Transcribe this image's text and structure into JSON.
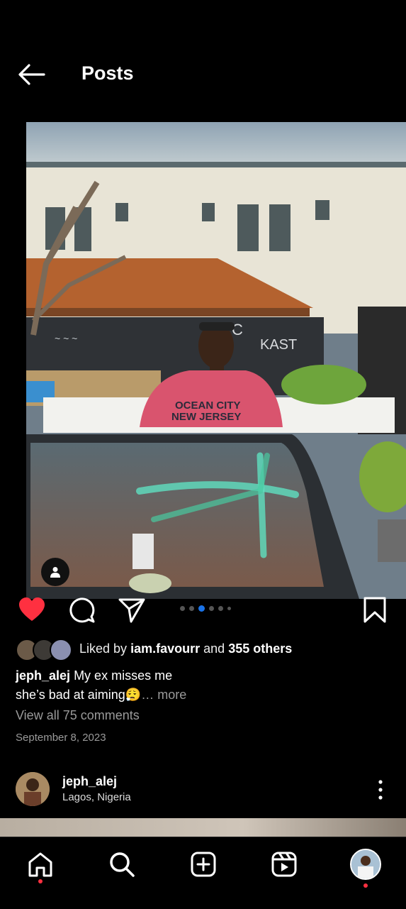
{
  "header": {
    "title": "Posts",
    "back_icon": "back-arrow-icon"
  },
  "post": {
    "image_alt_subject": "",
    "carousel": {
      "total": 6,
      "active": 2
    },
    "actions": {
      "like_icon": "heart-filled-icon",
      "like_color": "#ff3040",
      "comment_icon": "comment-icon",
      "share_icon": "send-icon",
      "save_icon": "bookmark-icon"
    },
    "likes": {
      "prefix": "Liked by",
      "user": "iam.favourr",
      "middle": "and",
      "others": "355 others"
    },
    "caption": {
      "username": "jeph_alej",
      "line1": "My ex misses me",
      "line2": "she’s bad at aiming",
      "emoji": "😮‍💨",
      "more": "… more"
    },
    "view_comments": "View all 75 comments",
    "date": "September 8, 2023"
  },
  "next_post": {
    "username": "jeph_alej",
    "location": "Lagos, Nigeria",
    "more_icon": "more-vertical-icon"
  },
  "bottom_nav": {
    "items": [
      {
        "icon": "home-icon"
      },
      {
        "icon": "search-icon"
      },
      {
        "icon": "create-icon"
      },
      {
        "icon": "reels-icon"
      },
      {
        "icon": "profile-avatar"
      }
    ],
    "notification_color": "#ff3040"
  }
}
